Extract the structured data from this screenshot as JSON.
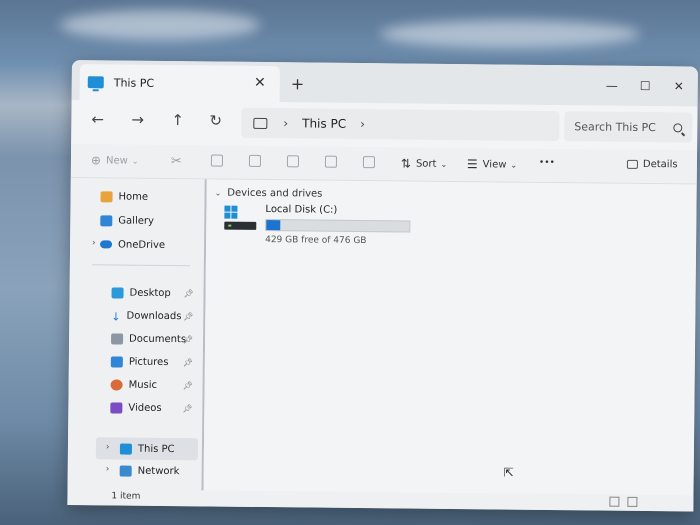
{
  "window": {
    "tab_title": "This PC",
    "close_glyph": "✕",
    "new_tab_glyph": "+",
    "minimize_glyph": "—",
    "maximize_glyph": "☐",
    "close_window_glyph": "✕"
  },
  "nav": {
    "back": "←",
    "forward": "→",
    "up": "↑",
    "refresh": "↻",
    "address_sep": "›",
    "address_path": "This PC",
    "address_sep2": "›",
    "search_placeholder": "Search This PC"
  },
  "toolbar": {
    "new_label": "New",
    "sort_label": "Sort",
    "view_label": "View",
    "more_label": "•••",
    "details_label": "Details"
  },
  "sidebar": {
    "home": "Home",
    "gallery": "Gallery",
    "onedrive": "OneDrive",
    "desktop": "Desktop",
    "downloads": "Downloads",
    "documents": "Documents",
    "pictures": "Pictures",
    "music": "Music",
    "videos": "Videos",
    "this_pc": "This PC",
    "network": "Network"
  },
  "content": {
    "group_header": "Devices and drives",
    "drive_name": "Local Disk (C:)",
    "drive_free": "429 GB free of 476 GB",
    "drive_used_fraction": 0.0987
  },
  "status": {
    "items": "1 item"
  },
  "colors": {
    "accent": "#1e73d0",
    "folder_blue": "#1e8fd6"
  }
}
